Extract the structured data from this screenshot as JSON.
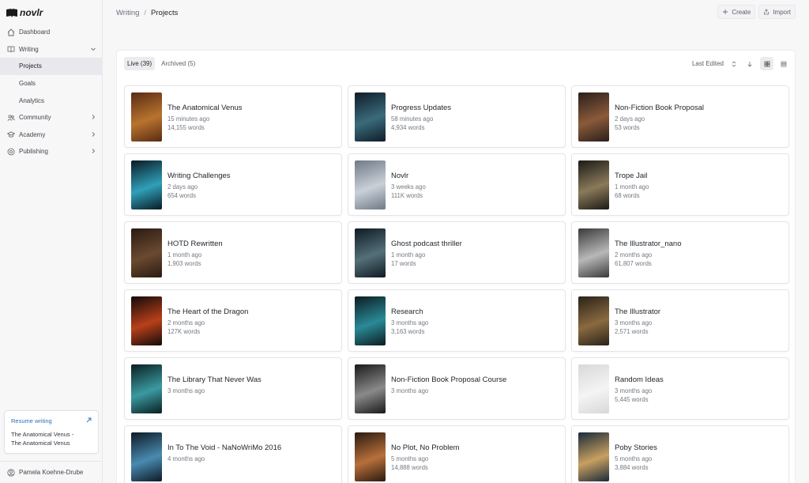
{
  "app": {
    "logo_text": "novlr"
  },
  "sidebar": {
    "items": [
      {
        "label": "Dashboard",
        "icon": "home-icon"
      },
      {
        "label": "Writing",
        "icon": "book-icon",
        "chevron": "down"
      },
      {
        "label": "Projects",
        "sub": true,
        "active": true
      },
      {
        "label": "Goals",
        "sub": true
      },
      {
        "label": "Analytics",
        "sub": true
      },
      {
        "label": "Community",
        "icon": "users-icon",
        "chevron": "right"
      },
      {
        "label": "Academy",
        "icon": "graduation-cap-icon",
        "chevron": "right"
      },
      {
        "label": "Publishing",
        "icon": "globe-icon",
        "chevron": "right"
      }
    ],
    "resume": {
      "title": "Resume writing",
      "line1": "The Anatomical Venus -",
      "line2": "The Anatomical Venus"
    },
    "user_name": "Pamela Koehne-Drube"
  },
  "breadcrumb": {
    "parent": "Writing",
    "separator": "/",
    "current": "Projects"
  },
  "top_actions": {
    "create": "Create",
    "import": "Import"
  },
  "tabs": {
    "live": "Live (39)",
    "archived": "Archived (5)"
  },
  "sort": {
    "label": "Last Edited"
  },
  "projects": [
    {
      "title": "The Anatomical Venus",
      "time": "15 minutes ago",
      "words": "14,155 words",
      "c1": "#5a2a14",
      "c2": "#b8742e"
    },
    {
      "title": "Progress Updates",
      "time": "58 minutes ago",
      "words": "4,934 words",
      "c1": "#0f1c2a",
      "c2": "#3a6b7a"
    },
    {
      "title": "Non-Fiction Book Proposal",
      "time": "2 days ago",
      "words": "53 words",
      "c1": "#2a1f1a",
      "c2": "#8a5a3a"
    },
    {
      "title": "Writing Challenges",
      "time": "2 days ago",
      "words": "654 words",
      "c1": "#0a1a24",
      "c2": "#2fa0b8"
    },
    {
      "title": "Novlr",
      "time": "3 weeks ago",
      "words": "111K words",
      "c1": "#6f7a86",
      "c2": "#c9d0d8"
    },
    {
      "title": "Trope Jail",
      "time": "1 month ago",
      "words": "68 words",
      "c1": "#1c1a16",
      "c2": "#8a7a5a"
    },
    {
      "title": "HOTD Rewritten",
      "time": "1 month ago",
      "words": "1,903 words",
      "c1": "#2a1a12",
      "c2": "#6a4a30"
    },
    {
      "title": "Ghost podcast thriller",
      "time": "1 month ago",
      "words": "17 words",
      "c1": "#0e1a22",
      "c2": "#55707a"
    },
    {
      "title": "The Illustrator_nano",
      "time": "2 months ago",
      "words": "61,807 words",
      "c1": "#3a3a3a",
      "c2": "#b8b8b8"
    },
    {
      "title": "The Heart of the Dragon",
      "time": "2 months ago",
      "words": "127K words",
      "c1": "#120a0a",
      "c2": "#b8401a"
    },
    {
      "title": "Research",
      "time": "3 months ago",
      "words": "3,163 words",
      "c1": "#0c1c22",
      "c2": "#2a8a96"
    },
    {
      "title": "The Illustrator",
      "time": "3 months ago",
      "words": "2,571 words",
      "c1": "#2a2218",
      "c2": "#8a6a40"
    },
    {
      "title": "The Library That Never Was",
      "time": "3 months ago",
      "words": "",
      "c1": "#0a1e22",
      "c2": "#3a9aa0"
    },
    {
      "title": "Non-Fiction Book Proposal Course",
      "time": "3 months ago",
      "words": "",
      "c1": "#1a1a1a",
      "c2": "#8a8a8a"
    },
    {
      "title": "Random Ideas",
      "time": "3 months ago",
      "words": "5,445 words",
      "c1": "#d8d8d8",
      "c2": "#f4f4f4"
    },
    {
      "title": "In To The Void - NaNoWriMo 2016",
      "time": "4 months ago",
      "words": "",
      "c1": "#0c1a24",
      "c2": "#4a8ab0"
    },
    {
      "title": "No Plot, No Problem",
      "time": "5 months ago",
      "words": "14,888 words",
      "c1": "#2a1a10",
      "c2": "#b8703a"
    },
    {
      "title": "Poby Stories",
      "time": "5 months ago",
      "words": "3,884 words",
      "c1": "#1a2a3a",
      "c2": "#c8a060"
    }
  ],
  "colors": {
    "accent": "#2a6fb8",
    "active_bg": "#e9e9ed"
  }
}
